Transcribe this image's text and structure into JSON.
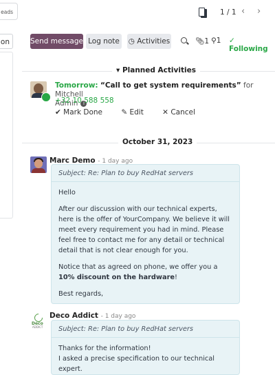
{
  "top": {
    "leads_tab": "eads",
    "pager": "1 / 1",
    "prev_icon": "chevron-left-icon",
    "next_icon": "chevron-right-icon"
  },
  "chatter": {
    "left_button": "on",
    "send_message": "Send message",
    "log_note": "Log note",
    "activities": "Activities",
    "attachments_count": "1",
    "followers_count": "1",
    "following": "Following"
  },
  "planned": {
    "title": "Planned Activities",
    "when": "Tomorrow:",
    "summary": "“Call to get system requirements”",
    "for_label": "for Mitchell",
    "assignee": "Admin",
    "phone": "+32 10 588 558",
    "mark_done": "Mark Done",
    "edit": "Edit",
    "cancel": "Cancel"
  },
  "date_separator": "October 31, 2023",
  "messages": [
    {
      "author": "Marc Demo",
      "time": "- 1 day ago",
      "subject": "Subject: Re: Plan to buy RedHat servers",
      "greeting": "Hello",
      "para1": "After our discussion with our technical experts, here is the offer of YourCompany. We believe it will meet every requirement you had in mind. Please feel free to contact me for any detail or technical detail that is not clear enough for you.",
      "para2_pre": "Notice that as agreed on phone, we offer you a ",
      "para2_bold": "10% discount on the hardware",
      "para2_post": "!",
      "closing": "Best regards,"
    },
    {
      "author": "Deco Addict",
      "time": "- 1 day ago",
      "logo_text": "Deco",
      "logo_sub": "ADDICT",
      "subject": "Subject: Re: Plan to buy RedHat servers",
      "line1": "Thanks for the information!",
      "line2": "I asked a precise specification to our technical expert."
    }
  ],
  "colors": {
    "primary": "#714b67",
    "success": "#28a745",
    "bubble_bg": "#e8f3f6"
  }
}
